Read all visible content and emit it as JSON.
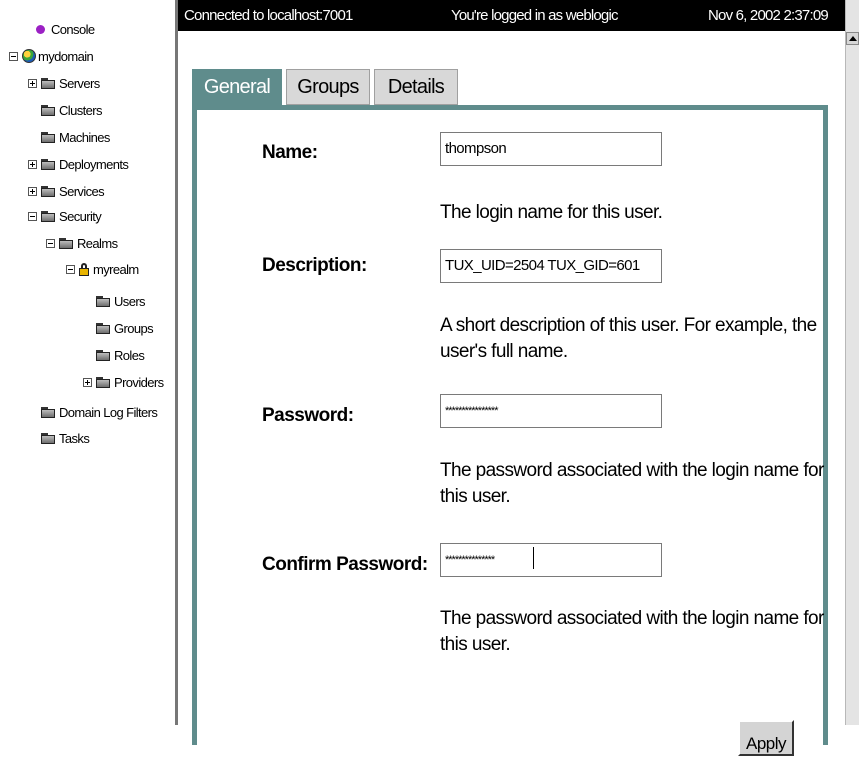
{
  "tree": {
    "console": "Console",
    "mydomain": "mydomain",
    "servers": "Servers",
    "clusters": "Clusters",
    "machines": "Machines",
    "deployments": "Deployments",
    "services": "Services",
    "security": "Security",
    "realms": "Realms",
    "myrealm": "myrealm",
    "users": "Users",
    "groups": "Groups",
    "roles": "Roles",
    "providers": "Providers",
    "domain_log_filters": "Domain Log Filters",
    "tasks": "Tasks"
  },
  "status_bar": {
    "connection": "Connected to localhost:7001",
    "login": "You're logged in as weblogic",
    "datetime": "Nov 6, 2002 2:37:09"
  },
  "tabs": {
    "general": "General",
    "groups": "Groups",
    "details": "Details"
  },
  "form": {
    "name": {
      "label": "Name:",
      "value": "thompson",
      "help": "The login name for this user."
    },
    "description": {
      "label": "Description:",
      "value": "TUX_UID=2504 TUX_GID=601",
      "help": "A short description of this user. For example, the user's full name."
    },
    "password": {
      "label": "Password:",
      "value": "****************",
      "help": "The password associated with the login name for this user."
    },
    "confirm_password": {
      "label": "Confirm Password:",
      "value": "***************",
      "help": "The password associated with the login name for this user."
    },
    "apply_label": "Apply"
  },
  "colors": {
    "tab_accent": "#5f8c8c",
    "status_bar_bg": "#000000",
    "console_icon": "#9b20c4"
  }
}
